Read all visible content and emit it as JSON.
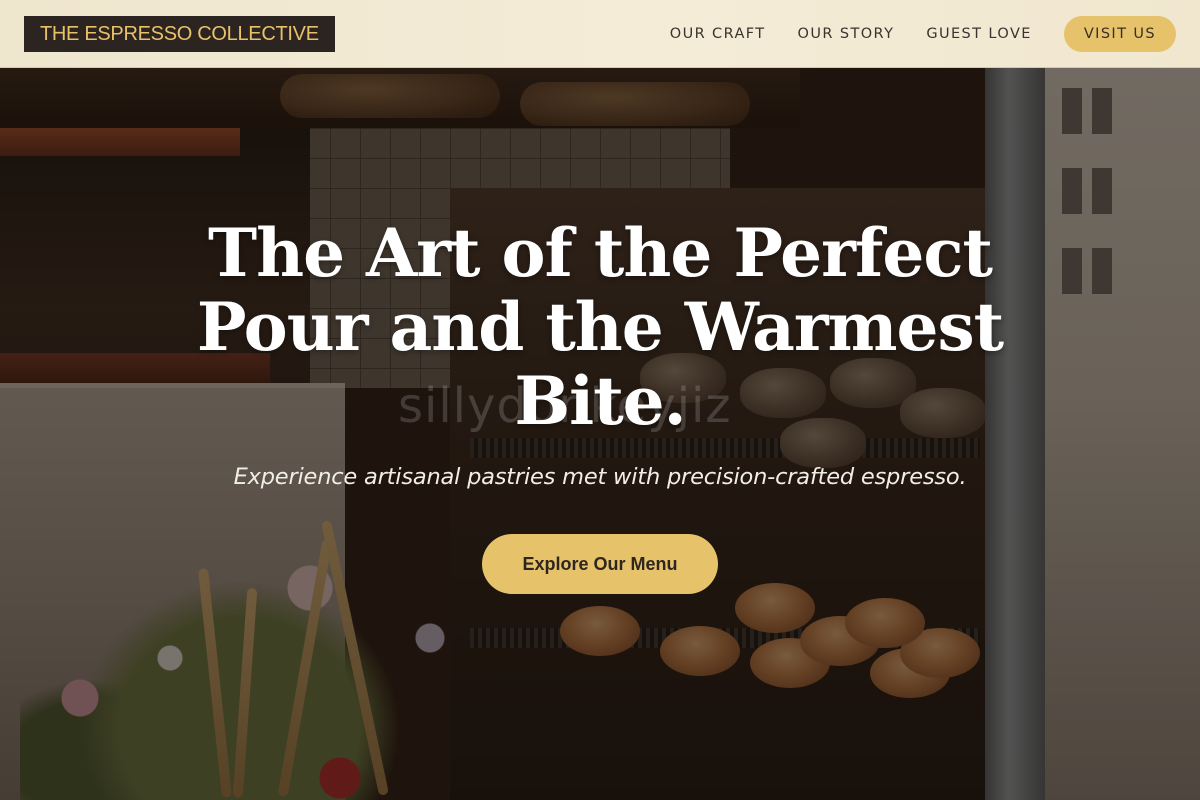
{
  "header": {
    "logo_text": "THE ESPRESSO COLLECTIVE",
    "nav": [
      {
        "label": "OUR CRAFT"
      },
      {
        "label": "OUR STORY"
      },
      {
        "label": "GUEST LOVE"
      }
    ],
    "cta_label": "VISIT US"
  },
  "hero": {
    "title": "The Art of the Perfect Pour and the Warmest Bite.",
    "subtitle": "Experience artisanal pastries met with precision-crafted espresso.",
    "cta_label": "Explore Our Menu",
    "background_image": "bakery display case with pastries and bread, dried flower arrangement in foreground",
    "watermark": "sillydonkeyjiz"
  },
  "colors": {
    "accent_gold": "#e6c26a",
    "header_bg": "#f2e9d3",
    "logo_bg": "#2c2420",
    "logo_text": "#e8c16a",
    "nav_text": "#3a332e",
    "hero_text": "#ffffff"
  }
}
